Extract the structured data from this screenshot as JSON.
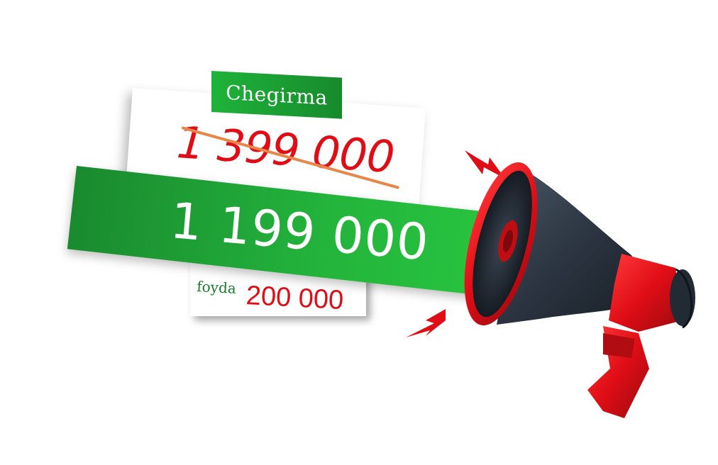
{
  "promo": {
    "tag_label": "Chegirma",
    "old_price": "1 399 000",
    "new_price": "1 199 000",
    "saving_label": "foyda",
    "saving_value": "200 000"
  },
  "colors": {
    "brand_green": "#23b43c",
    "price_red": "#e00d16",
    "strike_orange": "#e8864a",
    "megaphone_body": "#2b3440"
  },
  "icons": [
    "megaphone-icon",
    "lightning-icon"
  ]
}
